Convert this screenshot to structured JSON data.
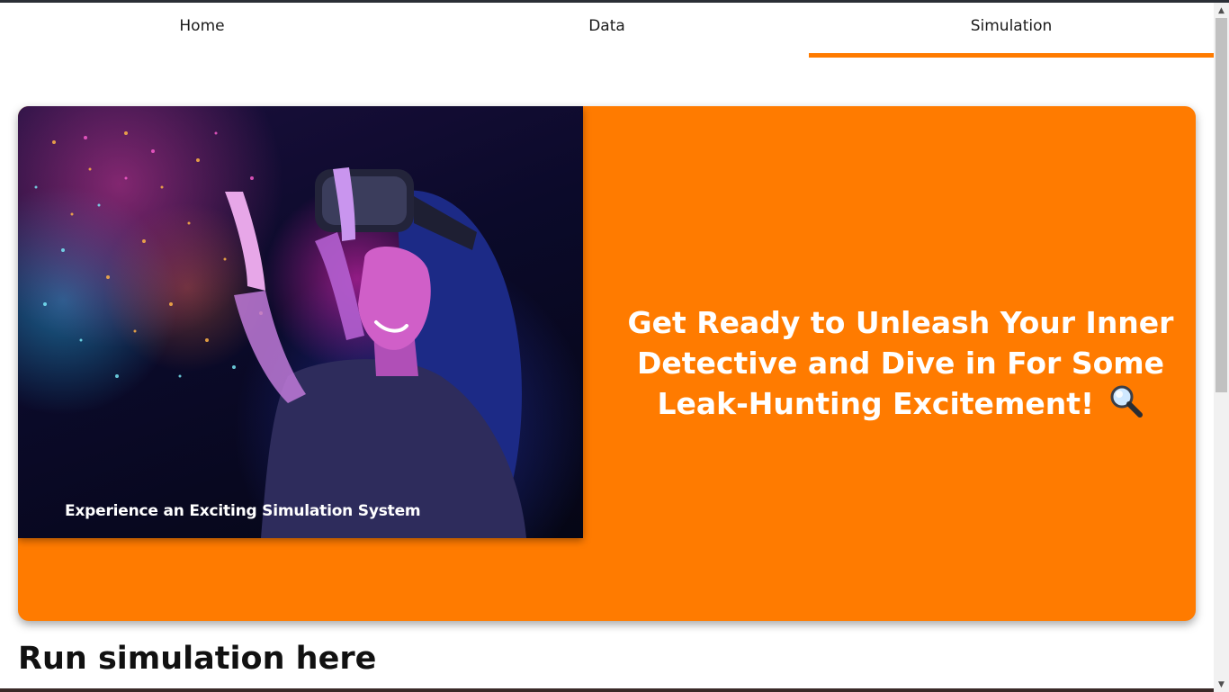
{
  "nav": {
    "tabs": [
      {
        "label": "Home"
      },
      {
        "label": "Data"
      },
      {
        "label": "Simulation"
      }
    ],
    "active_tab": "Simulation"
  },
  "hero": {
    "image_caption": "Experience an Exciting Simulation System",
    "headline": "Get Ready to Unleash Your Inner Detective and Dive in For Some Leak-Hunting Excitement!",
    "headline_icon": "magnifying-glass-icon"
  },
  "main": {
    "section_title": "Run simulation here"
  },
  "colors": {
    "accent": "#ff7b00",
    "text_dark": "#111111",
    "on_accent": "#ffffff"
  }
}
